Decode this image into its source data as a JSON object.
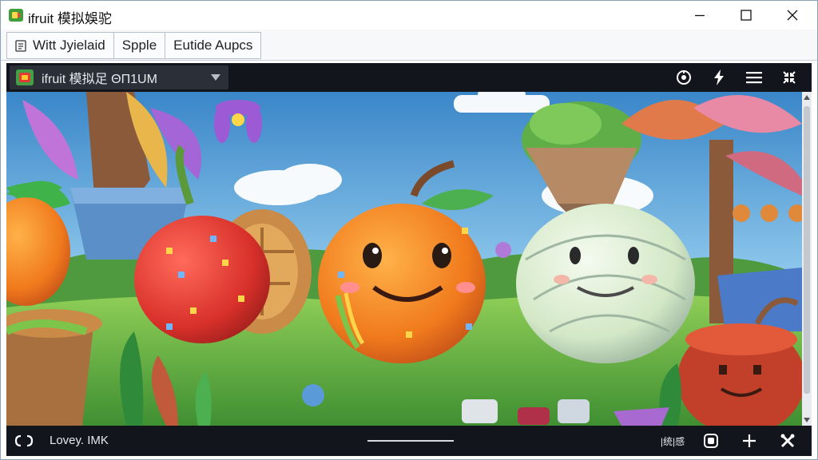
{
  "window": {
    "title": "ifruit 模拟娛驼",
    "minimize_icon": "minimize-icon",
    "maximize_icon": "maximize-icon",
    "close_icon": "close-icon"
  },
  "menubar": {
    "items": [
      {
        "label": "Witt Jyielaid",
        "icon": "document-icon"
      },
      {
        "label": "Spple"
      },
      {
        "label": "Eutide  Aupcs"
      }
    ]
  },
  "viewer": {
    "selector_label": "ifruit 模拟足 ΘΠ1UM",
    "top_tools": [
      "gamepad-icon",
      "lightning-icon",
      "menu-icon",
      "collapse-icon"
    ],
    "bottom_label": "Lovey. IMK",
    "bottom_tools": [
      {
        "name": "stats-button",
        "text": "|统|感"
      },
      {
        "name": "screenshot-button",
        "icon": "screenshot-icon"
      },
      {
        "name": "add-button",
        "icon": "plus-icon"
      },
      {
        "name": "tools-button",
        "icon": "tools-icon"
      }
    ]
  },
  "colors": {
    "accent": "#4caf50",
    "viewer_bg": "#0d0f14",
    "toolbar_bg": "#12151c"
  }
}
